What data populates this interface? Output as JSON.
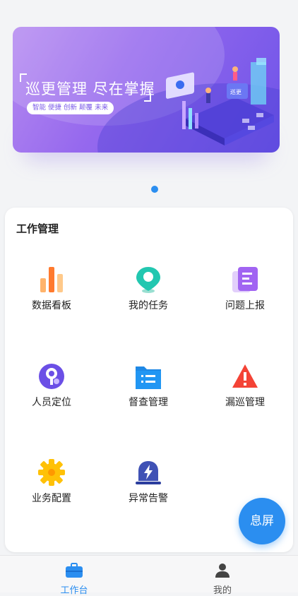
{
  "banner": {
    "title": "巡更管理 尽在掌握",
    "tags": "智能  便捷  创新  颠覆  未来",
    "illustration_text": "巡更"
  },
  "section": {
    "title": "工作管理"
  },
  "tiles": [
    {
      "label": "数据看板",
      "icon": "bar-chart-icon"
    },
    {
      "label": "我的任务",
      "icon": "location-pin-icon"
    },
    {
      "label": "问题上报",
      "icon": "document-icon"
    },
    {
      "label": "人员定位",
      "icon": "person-location-icon"
    },
    {
      "label": "督查管理",
      "icon": "folder-list-icon"
    },
    {
      "label": "漏巡管理",
      "icon": "warning-icon"
    },
    {
      "label": "业务配置",
      "icon": "gear-icon"
    },
    {
      "label": "异常告警",
      "icon": "alarm-light-icon"
    }
  ],
  "fab": {
    "label": "息屏"
  },
  "nav": {
    "items": [
      {
        "label": "工作台",
        "icon": "briefcase-icon",
        "active": true
      },
      {
        "label": "我的",
        "icon": "person-icon",
        "active": false
      }
    ]
  },
  "colors": {
    "accent": "#2b8ef0",
    "banner_start": "#b58af0",
    "banner_end": "#6e54e8"
  }
}
